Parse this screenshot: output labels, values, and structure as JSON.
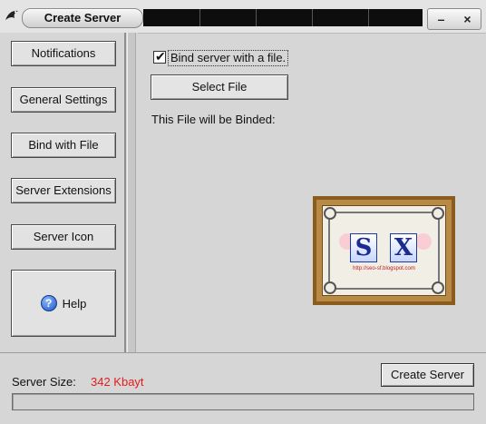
{
  "window": {
    "title": "Create Server",
    "minimize_glyph": "–",
    "close_glyph": "×",
    "icon": "bird-app-icon"
  },
  "sidebar": {
    "items": [
      {
        "label": "Notifications"
      },
      {
        "label": "General Settings"
      },
      {
        "label": "Bind with File"
      },
      {
        "label": "Server Extensions"
      },
      {
        "label": "Server Icon"
      }
    ],
    "help": {
      "label": "Help",
      "icon": "help-icon",
      "glyph": "?"
    }
  },
  "bind": {
    "checkbox_checked": true,
    "checkbox_label": "Bind server with a file.",
    "select_button": "Select File",
    "info_label": "This File will be Binded:"
  },
  "picture": {
    "letters": [
      "S",
      "X"
    ],
    "url": "http://seo-sf.blogspot.com"
  },
  "footer": {
    "size_label": "Server Size:",
    "size_value": "342 Kbayt",
    "size_color": "#e41c1c",
    "create_button": "Create Server",
    "progress": 0
  }
}
